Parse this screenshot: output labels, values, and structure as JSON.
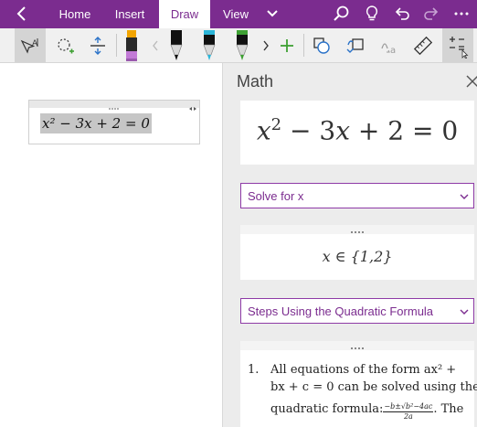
{
  "tabs": [
    {
      "label": "Home",
      "active": false
    },
    {
      "label": "Insert",
      "active": false
    },
    {
      "label": "Draw",
      "active": true
    },
    {
      "label": "View",
      "active": false
    }
  ],
  "colors": {
    "brand": "#7b2c8f",
    "pen_black": "#111111",
    "pen_cyan": "#2bb5d8",
    "pen_green": "#3ea033",
    "highlighter_purple": "#c27ad6",
    "accent_green": "#3ea033"
  },
  "icons": {
    "back": "back-arrow-icon",
    "more_tabs": "chevron-down-icon",
    "search": "search-icon",
    "lightbulb": "lightbulb-icon",
    "undo": "undo-icon",
    "redo": "redo-icon",
    "more": "more-icon"
  },
  "note": {
    "equation": "x² − 3x + 2 = 0"
  },
  "math_pane": {
    "title": "Math",
    "equation": "x² − 3x + 2 = 0",
    "action_select": "Solve for x",
    "result": "x ∈ {1,2}",
    "method_select": "Steps Using the Quadratic Formula",
    "steps": {
      "number": "1.",
      "line1": "All equations of the form ax² +",
      "line2": "bx + c = 0 can be solved using the",
      "line3a": "quadratic formula: ",
      "fraction_num": "−b±√b²−4ac",
      "fraction_den": "2a",
      "line3b": ". The"
    }
  }
}
